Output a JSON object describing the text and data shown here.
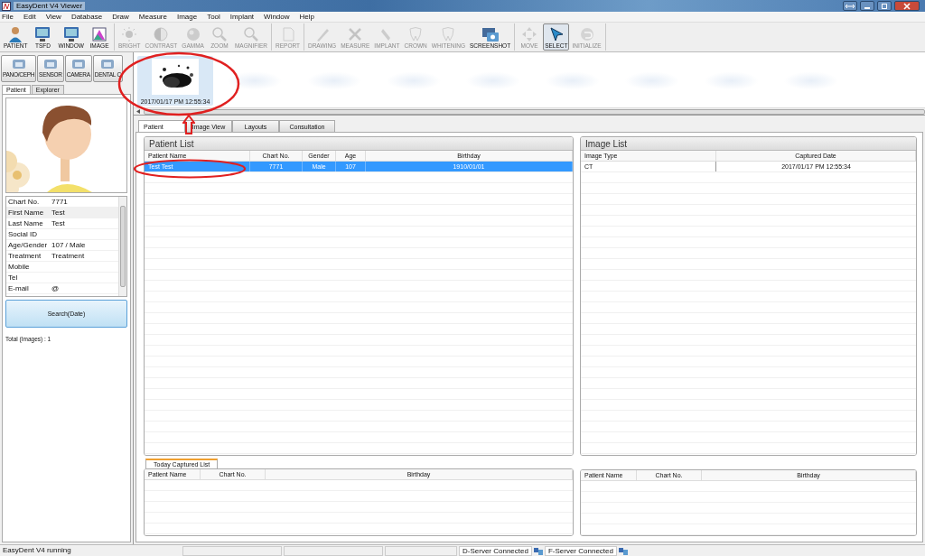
{
  "window": {
    "title": "EasyDent V4 Viewer"
  },
  "menu": [
    "File",
    "Edit",
    "View",
    "Database",
    "Draw",
    "Measure",
    "Image",
    "Tool",
    "Implant",
    "Window",
    "Help"
  ],
  "toolbar": [
    [
      {
        "label": "PATIENT",
        "disabled": false,
        "selected": false
      },
      {
        "label": "TSFD",
        "disabled": false,
        "selected": false
      },
      {
        "label": "WINDOW",
        "disabled": false,
        "selected": false
      },
      {
        "label": "IMAGE",
        "disabled": false,
        "selected": false
      }
    ],
    [
      {
        "label": "BRIGHT",
        "disabled": true,
        "selected": false
      },
      {
        "label": "CONTRAST",
        "disabled": true,
        "selected": false
      },
      {
        "label": "GAMMA",
        "disabled": true,
        "selected": false
      },
      {
        "label": "ZOOM",
        "disabled": true,
        "selected": false
      },
      {
        "label": "MAGNIFIER",
        "disabled": true,
        "selected": false
      }
    ],
    [
      {
        "label": "REPORT",
        "disabled": true,
        "selected": false
      }
    ],
    [
      {
        "label": "DRAWING",
        "disabled": true,
        "selected": false
      },
      {
        "label": "MEASURE",
        "disabled": true,
        "selected": false
      },
      {
        "label": "IMPLANT",
        "disabled": true,
        "selected": false
      },
      {
        "label": "CROWN",
        "disabled": true,
        "selected": false
      },
      {
        "label": "WHITENING",
        "disabled": true,
        "selected": false
      },
      {
        "label": "SCREENSHOT",
        "disabled": false,
        "selected": false
      }
    ],
    [
      {
        "label": "MOVE",
        "disabled": true,
        "selected": false
      },
      {
        "label": "SELECT",
        "disabled": false,
        "selected": true
      },
      {
        "label": "INITIALIZE",
        "disabled": true,
        "selected": false
      }
    ]
  ],
  "devices": [
    "PANO/CEPH",
    "SENSOR",
    "CAMERA",
    "DENTAL C"
  ],
  "side_tabs": [
    {
      "label": "Patient",
      "selected": true
    },
    {
      "label": "Explorer",
      "selected": false
    }
  ],
  "patient_info": [
    {
      "label": "Chart No.",
      "value": "7771",
      "selected": false
    },
    {
      "label": "First Name",
      "value": "Test",
      "selected": true
    },
    {
      "label": "Last Name",
      "value": "Test",
      "selected": false
    },
    {
      "label": "Social ID",
      "selected": false
    },
    {
      "label": "Age/Gender",
      "value": "107 / Male",
      "selected": false
    },
    {
      "label": "Treatment",
      "value": "Treatment",
      "selected": false
    },
    {
      "label": "Mobile",
      "selected": false
    },
    {
      "label": "Tel",
      "selected": false
    },
    {
      "label": "E-mail",
      "value": "@",
      "selected": false
    }
  ],
  "search_button": "Search(Date)",
  "total": "Total (Images) : 1",
  "thumbnails": [
    {
      "caption": "2017/01/17 PM 12:55:34",
      "selected": true
    },
    {
      "kind": "empty"
    },
    {
      "kind": "empty"
    },
    {
      "kind": "empty"
    },
    {
      "kind": "empty"
    },
    {
      "kind": "empty"
    },
    {
      "kind": "empty"
    },
    {
      "kind": "empty"
    },
    {
      "kind": "empty"
    }
  ],
  "main_tabs": [
    {
      "label": "Patient",
      "selected": true
    },
    {
      "label": "Image View",
      "selected": false
    },
    {
      "label": "Layouts",
      "selected": false
    },
    {
      "label": "Consultation",
      "selected": false
    }
  ],
  "patient_list": {
    "title": "Patient List",
    "columns": [
      "Patient Name",
      "Chart No.",
      "Gender",
      "Age",
      "Birthday"
    ],
    "rows": [
      {
        "cells": [
          "Test Test",
          "7771",
          "Male",
          "107",
          "1910/01/01"
        ],
        "selected": true
      }
    ]
  },
  "image_list": {
    "title": "Image List",
    "columns": [
      "Image Type",
      "Captured Date"
    ],
    "rows": [
      {
        "cells": [
          "CT",
          "2017/01/17 PM 12:55:34"
        ],
        "selected": false
      }
    ]
  },
  "today_tab": "Today Captured List",
  "today_left": {
    "columns": [
      "Patient Name",
      "Chart No.",
      "Birthday"
    ]
  },
  "today_right": {
    "columns": [
      "Patient Name",
      "Chart No.",
      "Birthday"
    ]
  },
  "status_bar": {
    "text": "EasyDent V4 running",
    "d_server": "D-Server Connected",
    "f_server": "F-Server Connected"
  }
}
